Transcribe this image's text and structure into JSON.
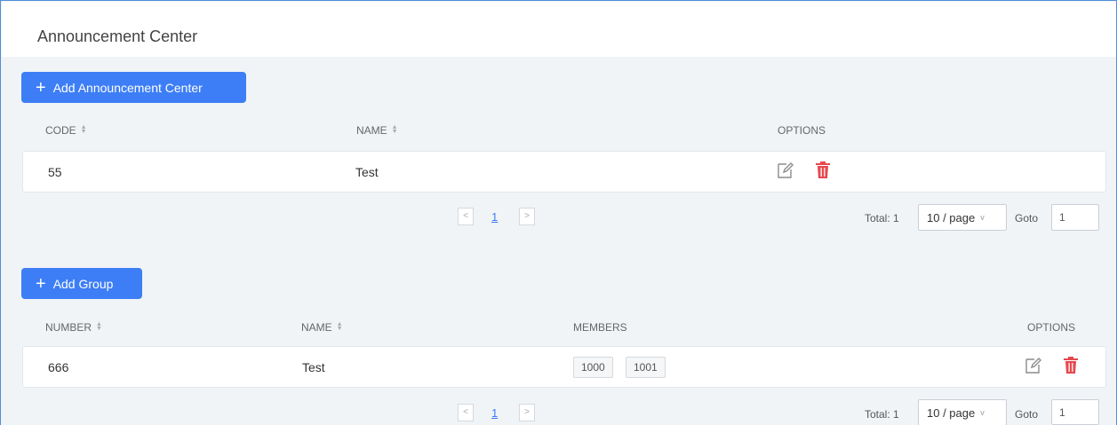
{
  "header": {
    "title": "Announcement Center"
  },
  "announcement_section": {
    "add_button": {
      "icon": "+",
      "label": "Add Announcement Center"
    },
    "columns": {
      "code": "CODE",
      "name": "NAME",
      "options": "OPTIONS"
    },
    "rows": [
      {
        "code": "55",
        "name": "Test"
      }
    ],
    "pagination": {
      "prev": "<",
      "page": "1",
      "next": ">",
      "total": "Total: 1",
      "page_size": "10 / page",
      "page_size_chevron": "v",
      "goto_label": "Goto",
      "goto_value": "1"
    }
  },
  "group_section": {
    "add_button": {
      "icon": "+",
      "label": "Add Group"
    },
    "columns": {
      "number": "NUMBER",
      "name": "NAME",
      "members": "MEMBERS",
      "options": "OPTIONS"
    },
    "rows": [
      {
        "number": "666",
        "name": "Test",
        "members": [
          "1000",
          "1001"
        ]
      }
    ],
    "pagination": {
      "prev": "<",
      "page": "1",
      "next": ">",
      "total": "Total: 1",
      "page_size": "10 / page",
      "page_size_chevron": "v",
      "goto_label": "Goto",
      "goto_value": "1"
    }
  },
  "icons": {
    "sort": "sort-icon",
    "edit": "edit-icon",
    "delete": "trash-icon",
    "add": "plus-icon"
  },
  "colors": {
    "accent": "#3d7ef6",
    "delete": "#e5484d",
    "frame": "#4d8fd8",
    "background": "#f0f4f7"
  }
}
